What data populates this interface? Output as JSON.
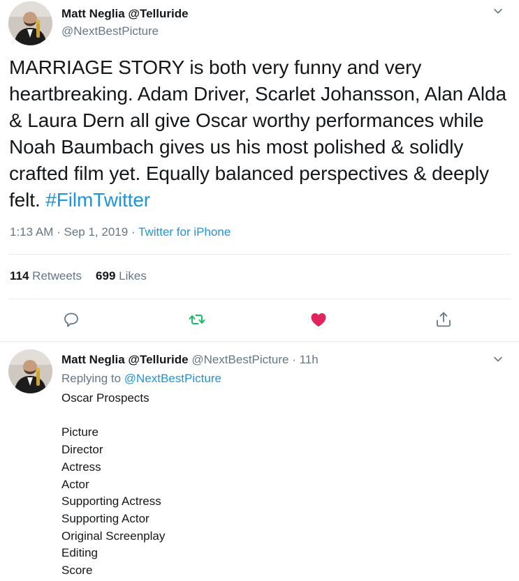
{
  "main_tweet": {
    "display_name": "Matt Neglia @Telluride",
    "handle": "@NextBestPicture",
    "text": "MARRIAGE STORY is both very funny and very heartbreaking. Adam Driver, Scarlet Johansson, Alan Alda & Laura Dern all give Oscar worthy performances while Noah Baumbach gives us his most polished & solidly crafted film yet. Equally balanced perspectives & deeply felt. ",
    "hashtag": "#FilmTwitter",
    "time": "1:13 AM",
    "date": "Sep 1, 2019",
    "source": "Twitter for iPhone",
    "retweets_count": "114",
    "retweets_label": "Retweets",
    "likes_count": "699",
    "likes_label": "Likes",
    "icons": {
      "reply": "reply-icon",
      "retweet": "retweet-icon",
      "like": "heart-icon",
      "share": "share-icon",
      "menu": "chevron-down-icon"
    },
    "colors": {
      "retweet": "#17bf63",
      "like": "#e0245e",
      "link": "#1b95e0"
    }
  },
  "reply_tweet": {
    "display_name": "Matt Neglia @Telluride",
    "handle": "@NextBestPicture",
    "separator": "·",
    "age": "11h",
    "replying_prefix": "Replying to",
    "replying_to": "@NextBestPicture",
    "heading": "Oscar Prospects",
    "categories": [
      "Picture",
      "Director",
      "Actress",
      "Actor",
      "Supporting Actress",
      "Supporting Actor",
      "Original Screenplay",
      "Editing",
      "Score"
    ]
  }
}
